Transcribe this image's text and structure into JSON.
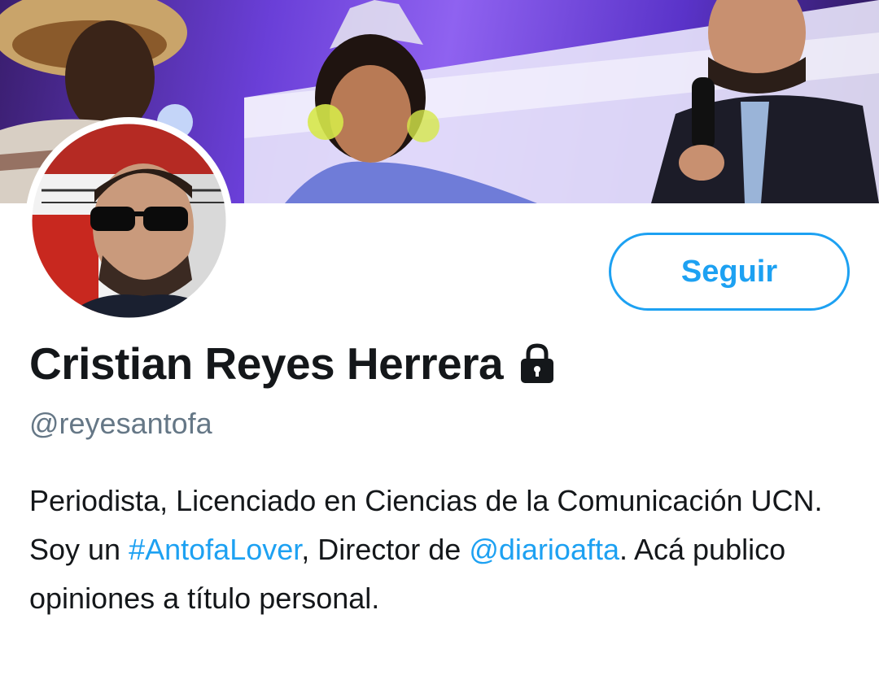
{
  "profile": {
    "display_name": "Cristian Reyes Herrera",
    "handle": "@reyesantofa",
    "follow_label": "Seguir",
    "protected_icon": "lock-icon",
    "bio": {
      "part1": "Periodista, Licenciado en Ciencias de la Comunicación UCN. Soy un ",
      "hashtag": "#AntofaLover",
      "part2": ", Director de ",
      "mention": "@diarioafta",
      "part3": ". Acá publico opiniones a título personal."
    }
  },
  "colors": {
    "accent": "#1da1f2",
    "text_primary": "#14171a",
    "text_secondary": "#657786",
    "background": "#ffffff"
  }
}
